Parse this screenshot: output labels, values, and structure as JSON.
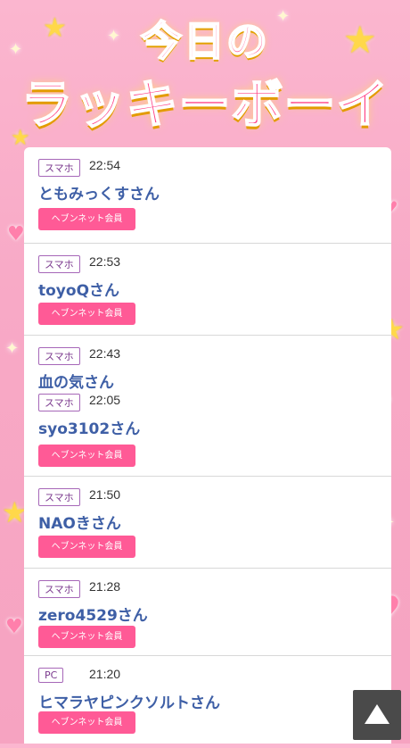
{
  "title": {
    "line1": "今日の",
    "line2": "ラッキーボーイ"
  },
  "entries": [
    {
      "badge": "スマホ",
      "time": "22:54",
      "name": "ともみっくすさん",
      "button": "ヘブンネット会員"
    },
    {
      "badge": "スマホ",
      "time": "22:53",
      "name": "toyoQさん",
      "button": "ヘブンネット会員"
    },
    {
      "badge": "スマホ",
      "time": "22:43",
      "name": "血の気さん"
    },
    {
      "badge": "スマホ",
      "time": "22:05",
      "name": "syo3102さん",
      "button": "ヘブンネット会員"
    },
    {
      "badge": "スマホ",
      "time": "21:50",
      "name": "NAOきさん",
      "button": "ヘブンネット会員"
    },
    {
      "badge": "スマホ",
      "time": "21:28",
      "name": "zero4529さん",
      "button": "ヘブンネット会員"
    },
    {
      "badge": "PC",
      "time": "21:20",
      "name": "ヒマラヤピンクソルトさん",
      "button": "ヘブンネット会員"
    }
  ],
  "icons": {
    "scroll_top": "arrow-up-icon"
  },
  "colors": {
    "accent": "#ff5a96",
    "name": "#3e5fa6",
    "badge_border": "#a667b8"
  }
}
